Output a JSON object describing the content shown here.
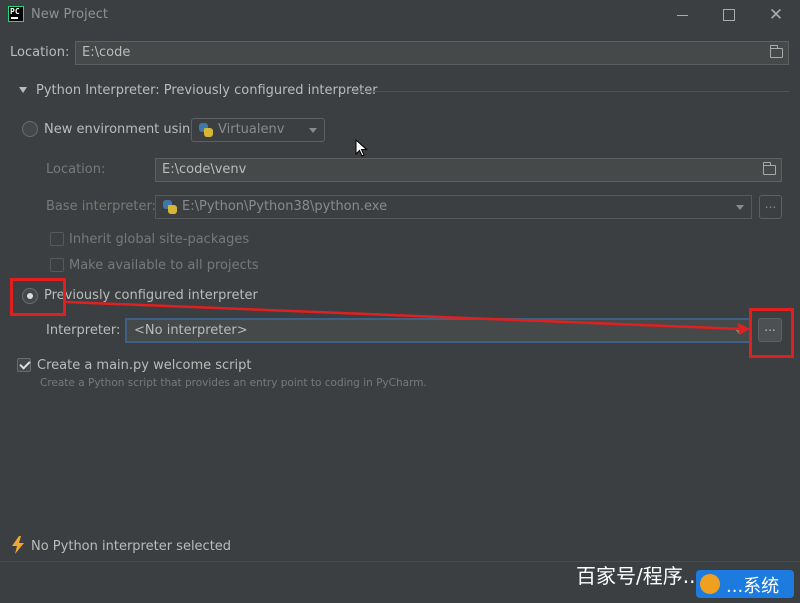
{
  "window": {
    "title": "New Project",
    "close_glyph": "✕"
  },
  "location": {
    "label": "Location:",
    "value": "E:\\code"
  },
  "interpreter_section": {
    "title": "Python Interpreter: Previously configured interpreter"
  },
  "new_env": {
    "label": "New environment using",
    "tool": "Virtualenv",
    "location_label": "Location:",
    "location_value": "E:\\code\\venv",
    "base_label": "Base interpreter:",
    "base_value": "E:\\Python\\Python38\\python.exe",
    "browse": "...",
    "inherit_label": "Inherit global site-packages",
    "available_label": "Make available to all projects"
  },
  "prev_config": {
    "label": "Previously configured interpreter",
    "interpreter_label": "Interpreter:",
    "interpreter_value": "<No interpreter>",
    "browse": "..."
  },
  "welcome": {
    "label": "Create a main.py welcome script",
    "hint": "Create a Python script that provides an entry point to coding in PyCharm.",
    "checked": true
  },
  "status": {
    "message": "No Python interpreter selected"
  },
  "watermark": {
    "text": "百家号/程序...",
    "badge": "...系统"
  },
  "colors": {
    "annotation": "#e02020",
    "accent": "#4a88c7"
  }
}
